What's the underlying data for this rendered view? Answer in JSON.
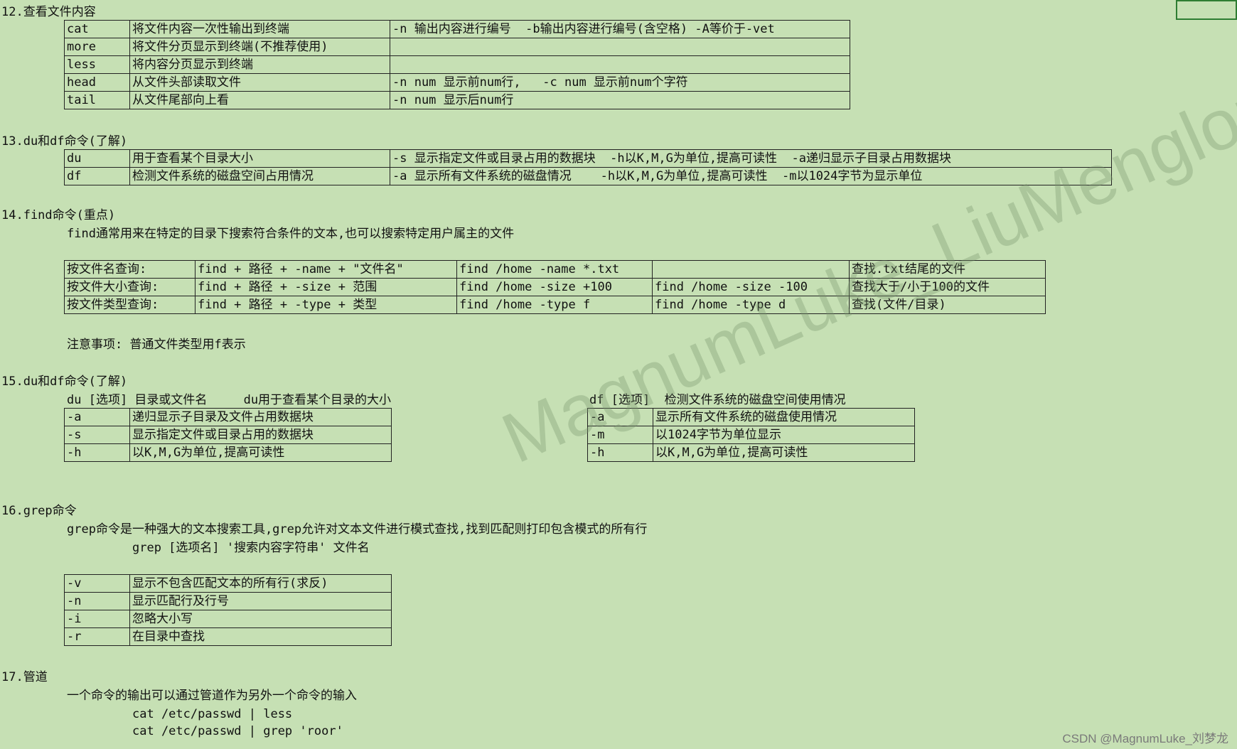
{
  "s12": {
    "heading": "12.查看文件内容",
    "rows": [
      [
        "cat",
        "将文件内容一次性输出到终端",
        "-n 输出内容进行编号  -b输出内容进行编号(含空格) -A等价于-vet"
      ],
      [
        "more",
        "将文件分页显示到终端(不推荐使用)",
        ""
      ],
      [
        "less",
        "将内容分页显示到终端",
        ""
      ],
      [
        "head",
        "从文件头部读取文件",
        "-n num 显示前num行,   -c num 显示前num个字符"
      ],
      [
        "tail",
        "从文件尾部向上看",
        "-n num 显示后num行"
      ]
    ]
  },
  "s13": {
    "heading": "13.du和df命令(了解)",
    "rows": [
      [
        "du",
        "用于查看某个目录大小",
        "-s 显示指定文件或目录占用的数据块  -h以K,M,G为单位,提高可读性  -a递归显示子目录占用数据块"
      ],
      [
        "df",
        "检测文件系统的磁盘空间占用情况",
        "-a 显示所有文件系统的磁盘情况    -h以K,M,G为单位,提高可读性  -m以1024字节为显示单位"
      ]
    ]
  },
  "s14": {
    "heading": "14.find命令(重点)",
    "desc": "find通常用来在特定的目录下搜索符合条件的文本,也可以搜索特定用户属主的文件",
    "rows": [
      [
        "按文件名查询:",
        "find + 路径 + -name + \"文件名\"",
        "find /home -name *.txt",
        "",
        "查找.txt结尾的文件"
      ],
      [
        "按文件大小查询:",
        "find + 路径 + -size + 范围",
        "find /home -size +100",
        "find /home -size -100",
        "查找大于/小于100的文件"
      ],
      [
        "按文件类型查询:",
        "find + 路径 + -type + 类型",
        "find /home -type f",
        "find /home -type d",
        "查找(文件/目录)"
      ]
    ],
    "note": "注意事项: 普通文件类型用f表示"
  },
  "s15": {
    "heading": "15.du和df命令(了解)",
    "du_title": "du [选项] 目录或文件名     du用于查看某个目录的大小",
    "df_title": "df [选项]  检测文件系统的磁盘空间使用情况",
    "du_rows": [
      [
        "-a",
        "递归显示子目录及文件占用数据块"
      ],
      [
        "-s",
        "显示指定文件或目录占用的数据块"
      ],
      [
        "-h",
        "以K,M,G为单位,提高可读性"
      ]
    ],
    "df_rows": [
      [
        "-a",
        "显示所有文件系统的磁盘使用情况"
      ],
      [
        "-m",
        "以1024字节为单位显示"
      ],
      [
        "-h",
        "以K,M,G为单位,提高可读性"
      ]
    ]
  },
  "s16": {
    "heading": "16.grep命令",
    "desc": "grep命令是一种强大的文本搜索工具,grep允许对文本文件进行模式查找,找到匹配则打印包含模式的所有行",
    "syntax": "grep [选项名] '搜索内容字符串' 文件名",
    "rows": [
      [
        "-v",
        "显示不包含匹配文本的所有行(求反)"
      ],
      [
        "-n",
        "显示匹配行及行号"
      ],
      [
        "-i",
        "忽略大小写"
      ],
      [
        "-r",
        "在目录中查找"
      ]
    ]
  },
  "s17": {
    "heading": "17.管道",
    "desc": "一个命令的输出可以通过管道作为另外一个命令的输入",
    "ex1": "cat /etc/passwd | less",
    "ex2": "cat /etc/passwd | grep 'roor'"
  },
  "watermark": "MagnumLuke_LiuMenglong",
  "footer": "CSDN @MagnumLuke_刘梦龙"
}
